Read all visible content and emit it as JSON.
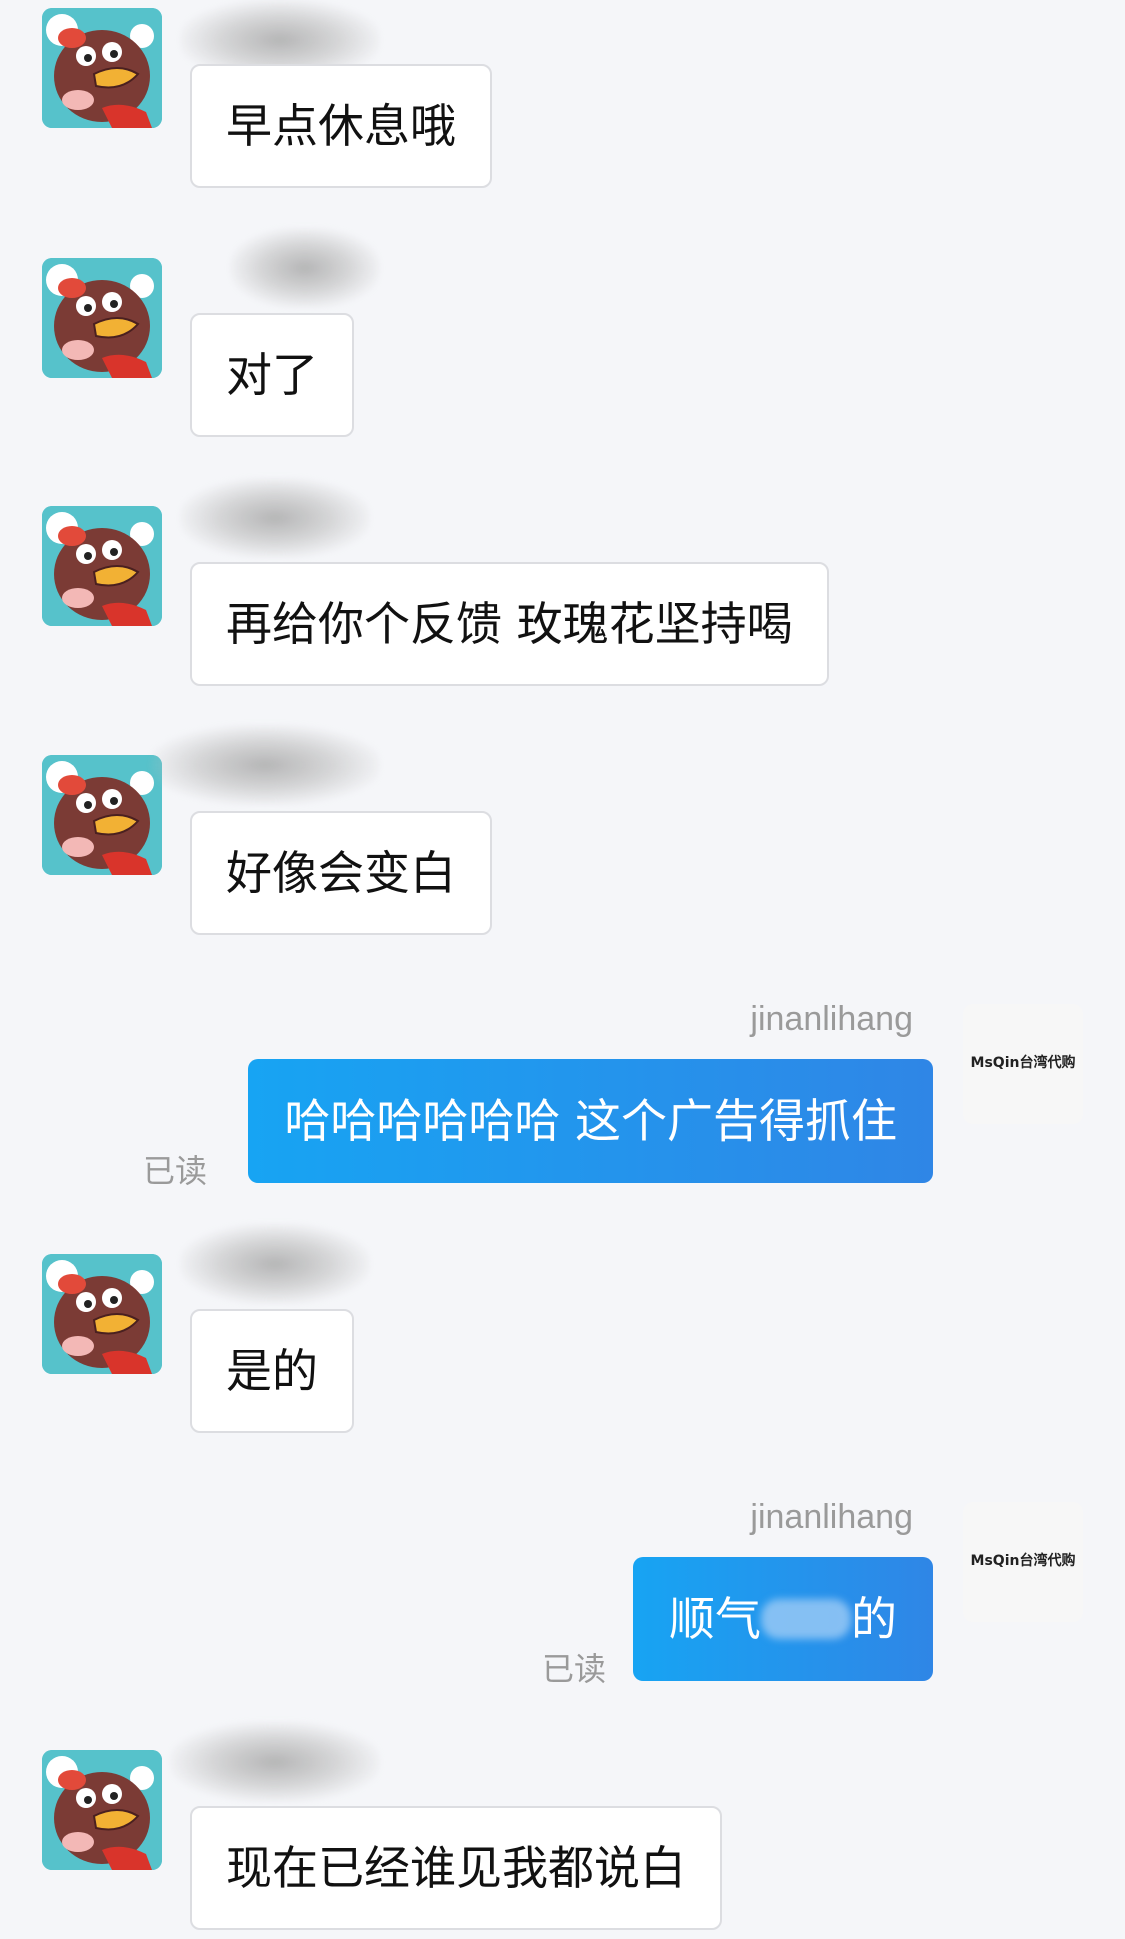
{
  "messages": [
    {
      "type": "in",
      "text": "早点休息哦"
    },
    {
      "type": "in",
      "text": "对了"
    },
    {
      "type": "in",
      "text": "再给你个反馈 玫瑰花坚持喝"
    },
    {
      "type": "in",
      "text": "好像会变白"
    },
    {
      "type": "out",
      "sender": "jinanlihang",
      "text": "哈哈哈哈哈哈 这个广告得抓住",
      "status": "已读",
      "avatar_logo": "MsQin台湾代购"
    },
    {
      "type": "in",
      "text": "是的"
    },
    {
      "type": "out",
      "sender": "jinanlihang",
      "text_before": "顺气",
      "text_after": "的",
      "status": "已读",
      "avatar_logo": "MsQin台湾代购"
    },
    {
      "type": "in",
      "text": "现在已经谁见我都说白"
    }
  ],
  "colors": {
    "background": "#f5f6f9",
    "incoming_bubble": "#ffffff",
    "outgoing_bubble_start": "#17a4f3",
    "outgoing_bubble_end": "#2f86e6",
    "meta_text": "#9a9a9a"
  },
  "icons": {
    "contact_avatar": "cartoon-duck-avatar",
    "self_avatar": "shop-logo-avatar"
  }
}
